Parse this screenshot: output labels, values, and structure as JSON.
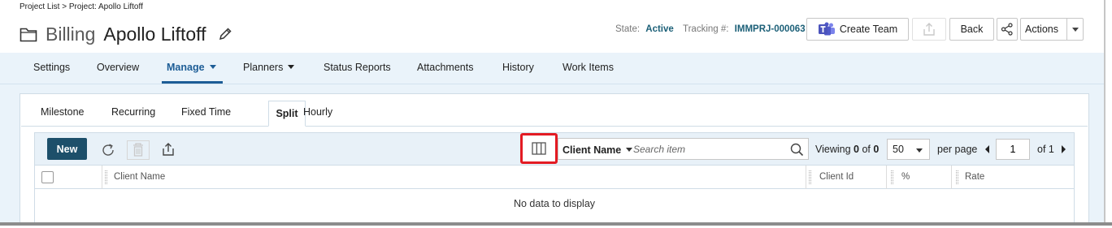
{
  "breadcrumb": "Project List > Project: Apollo Liftoff",
  "title": {
    "prefix": "Billing",
    "name": "Apollo Liftoff"
  },
  "meta": {
    "state_label": "State:",
    "state_value": "Active",
    "tracking_label": "Tracking #:",
    "tracking_value": "IMMPRJ-000063"
  },
  "header_buttons": {
    "create_team": "Create Team",
    "back": "Back",
    "actions": "Actions"
  },
  "main_tabs": [
    {
      "label": "Settings"
    },
    {
      "label": "Overview"
    },
    {
      "label": "Manage",
      "active": true
    },
    {
      "label": "Planners"
    },
    {
      "label": "Status Reports"
    },
    {
      "label": "Attachments"
    },
    {
      "label": "History"
    },
    {
      "label": "Work Items"
    }
  ],
  "sub_tabs": [
    {
      "label": "Milestone"
    },
    {
      "label": "Recurring"
    },
    {
      "label": "Fixed Time"
    },
    {
      "label": "Split",
      "active": true
    },
    {
      "label": "Hourly"
    }
  ],
  "toolbar": {
    "new_label": "New",
    "search_field": "Client Name",
    "search_placeholder": "Search item",
    "viewing_label": "Viewing",
    "viewing_from": "0",
    "viewing_of": "of",
    "viewing_total": "0",
    "per_page_value": "50",
    "per_page_label": "per page",
    "page_value": "1",
    "page_of": "of 1"
  },
  "columns": [
    "Client Name",
    "Client Id",
    "%",
    "Rate"
  ],
  "empty_message": "No data to display",
  "colors": {
    "accent": "#1d5d96",
    "primary_button": "#1d4f6a",
    "highlight": "#e31b23",
    "nav_bg": "#eaf3fa",
    "tracking": "#1b5f77"
  }
}
